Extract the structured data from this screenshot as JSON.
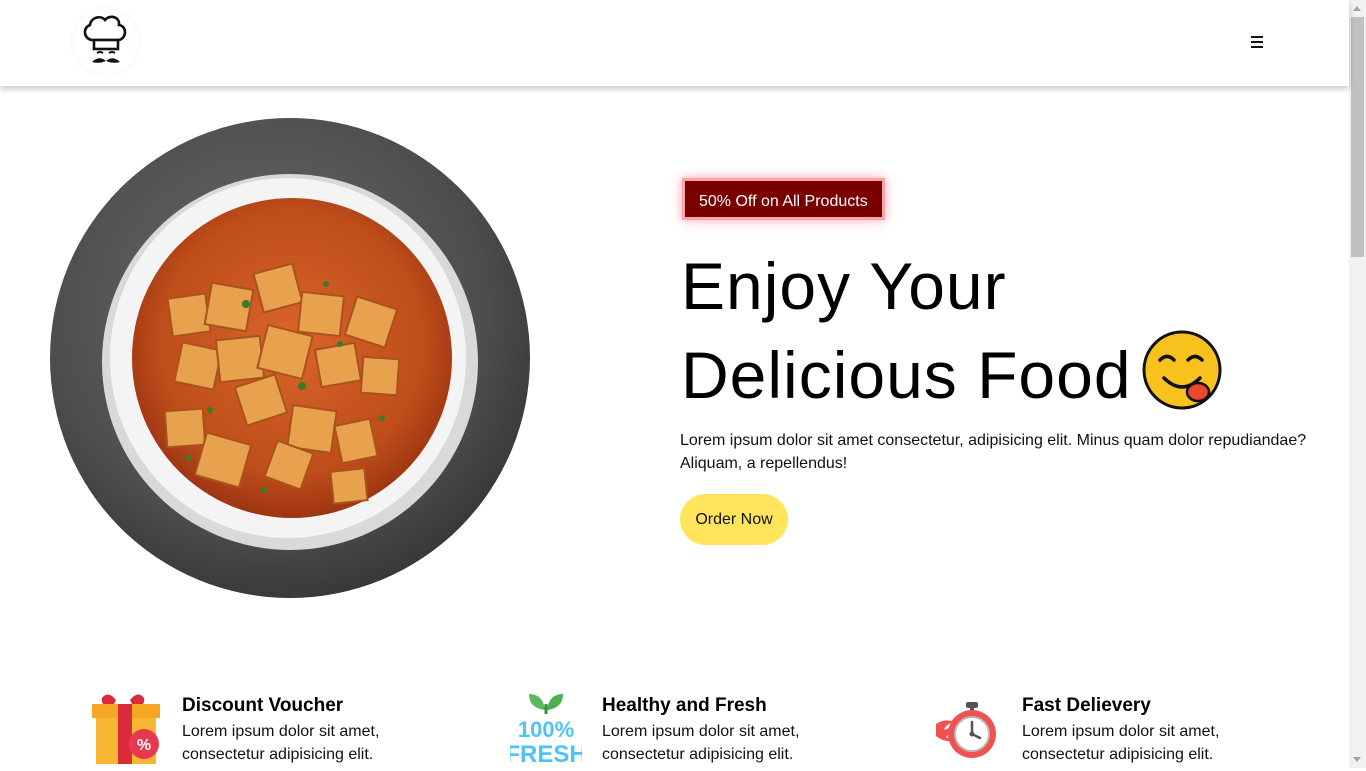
{
  "header": {
    "logo_icon": "chef-hat-logo-icon",
    "menu_icon": "hamburger-menu-icon"
  },
  "hero": {
    "badge": "50% Off on All Products",
    "title_line1": "Enjoy Your",
    "title_line2": "Delicious Food",
    "emoji_icon": "yum-face-emoji-icon",
    "description": "Lorem ipsum dolor sit amet consectetur, adipisicing elit. Minus quam dolor repudiandae? Aliquam, a repellendus!",
    "cta_label": "Order Now",
    "image_icon": "paneer-curry-bowl-image"
  },
  "features": [
    {
      "icon": "gift-voucher-icon",
      "title": "Discount Voucher",
      "text": "Lorem ipsum dolor sit amet, consectetur adipisicing elit."
    },
    {
      "icon": "fresh-100-icon",
      "title": "Healthy and Fresh",
      "text": "Lorem ipsum dolor sit amet, consectetur adipisicing elit."
    },
    {
      "icon": "stopwatch-delivery-icon",
      "title": "Fast Delievery",
      "text": "Lorem ipsum dolor sit amet, consectetur adipisicing elit."
    }
  ],
  "fresh_icon_text": {
    "line1": "100%",
    "line2": "FRESH"
  },
  "colors": {
    "badge_bg": "#7a0000",
    "badge_border": "#f6a4ad",
    "cta_bg": "#ffe45c",
    "curry": "#c9541c"
  }
}
